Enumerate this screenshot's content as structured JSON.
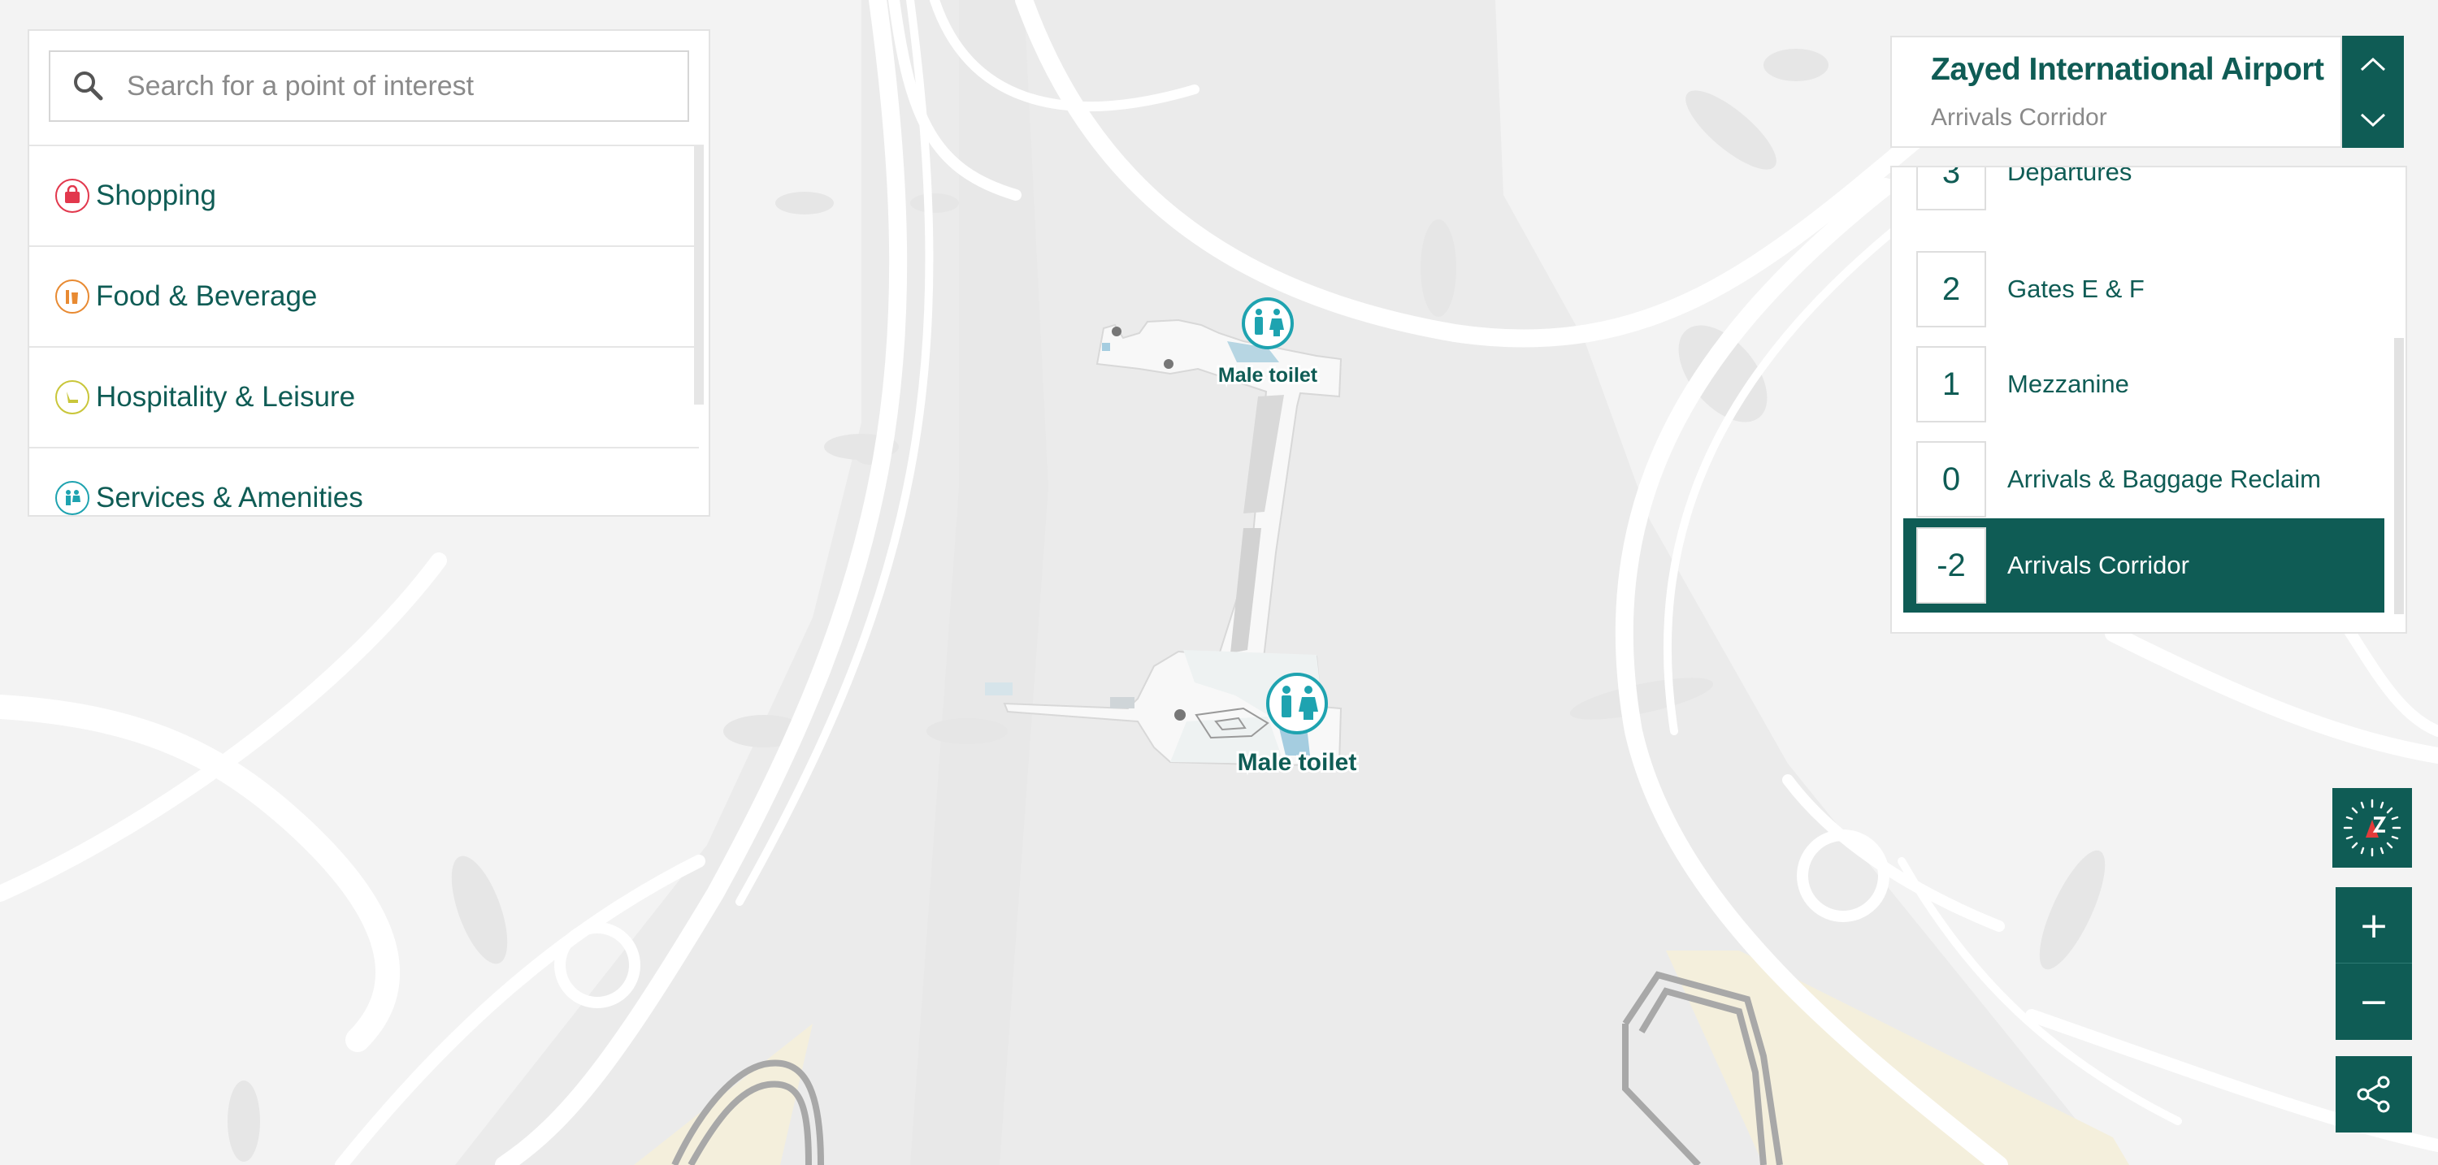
{
  "search": {
    "placeholder": "Search for a point of interest"
  },
  "categories": [
    {
      "label": "Shopping",
      "icon": "shopping-bag-icon",
      "color": "#e2384d"
    },
    {
      "label": "Food & Beverage",
      "icon": "food-beverage-icon",
      "color": "#e88a32"
    },
    {
      "label": "Hospitality & Leisure",
      "icon": "hospitality-icon",
      "color": "#c9c63a"
    },
    {
      "label": "Services & Amenities",
      "icon": "services-icon",
      "color": "#1ea3b0"
    }
  ],
  "header": {
    "airport_name": "Zayed International Airport",
    "current_level": "Arrivals Corridor"
  },
  "floors": [
    {
      "number": "3",
      "label": "Departures",
      "active": false
    },
    {
      "number": "2",
      "label": "Gates E & F",
      "active": false
    },
    {
      "number": "1",
      "label": "Mezzanine",
      "active": false
    },
    {
      "number": "0",
      "label": "Arrivals & Baggage Reclaim",
      "active": false
    },
    {
      "number": "-2",
      "label": "Arrivals Corridor",
      "active": true
    }
  ],
  "map_labels": [
    {
      "text": "Male toilet",
      "icon": "male-female-toilet-icon"
    },
    {
      "text": "Male toilet",
      "icon": "male-female-toilet-icon"
    }
  ],
  "controls": {
    "compass_icon": "compass-icon",
    "zoom_in": "+",
    "zoom_out": "−",
    "share_icon": "share-icon"
  },
  "colors": {
    "brand": "#0f5c55",
    "poi": "#1ea3b0",
    "map_bg": "#f2f2f2",
    "terminal_area": "#ebebeb",
    "sand": "#f4efdc"
  }
}
